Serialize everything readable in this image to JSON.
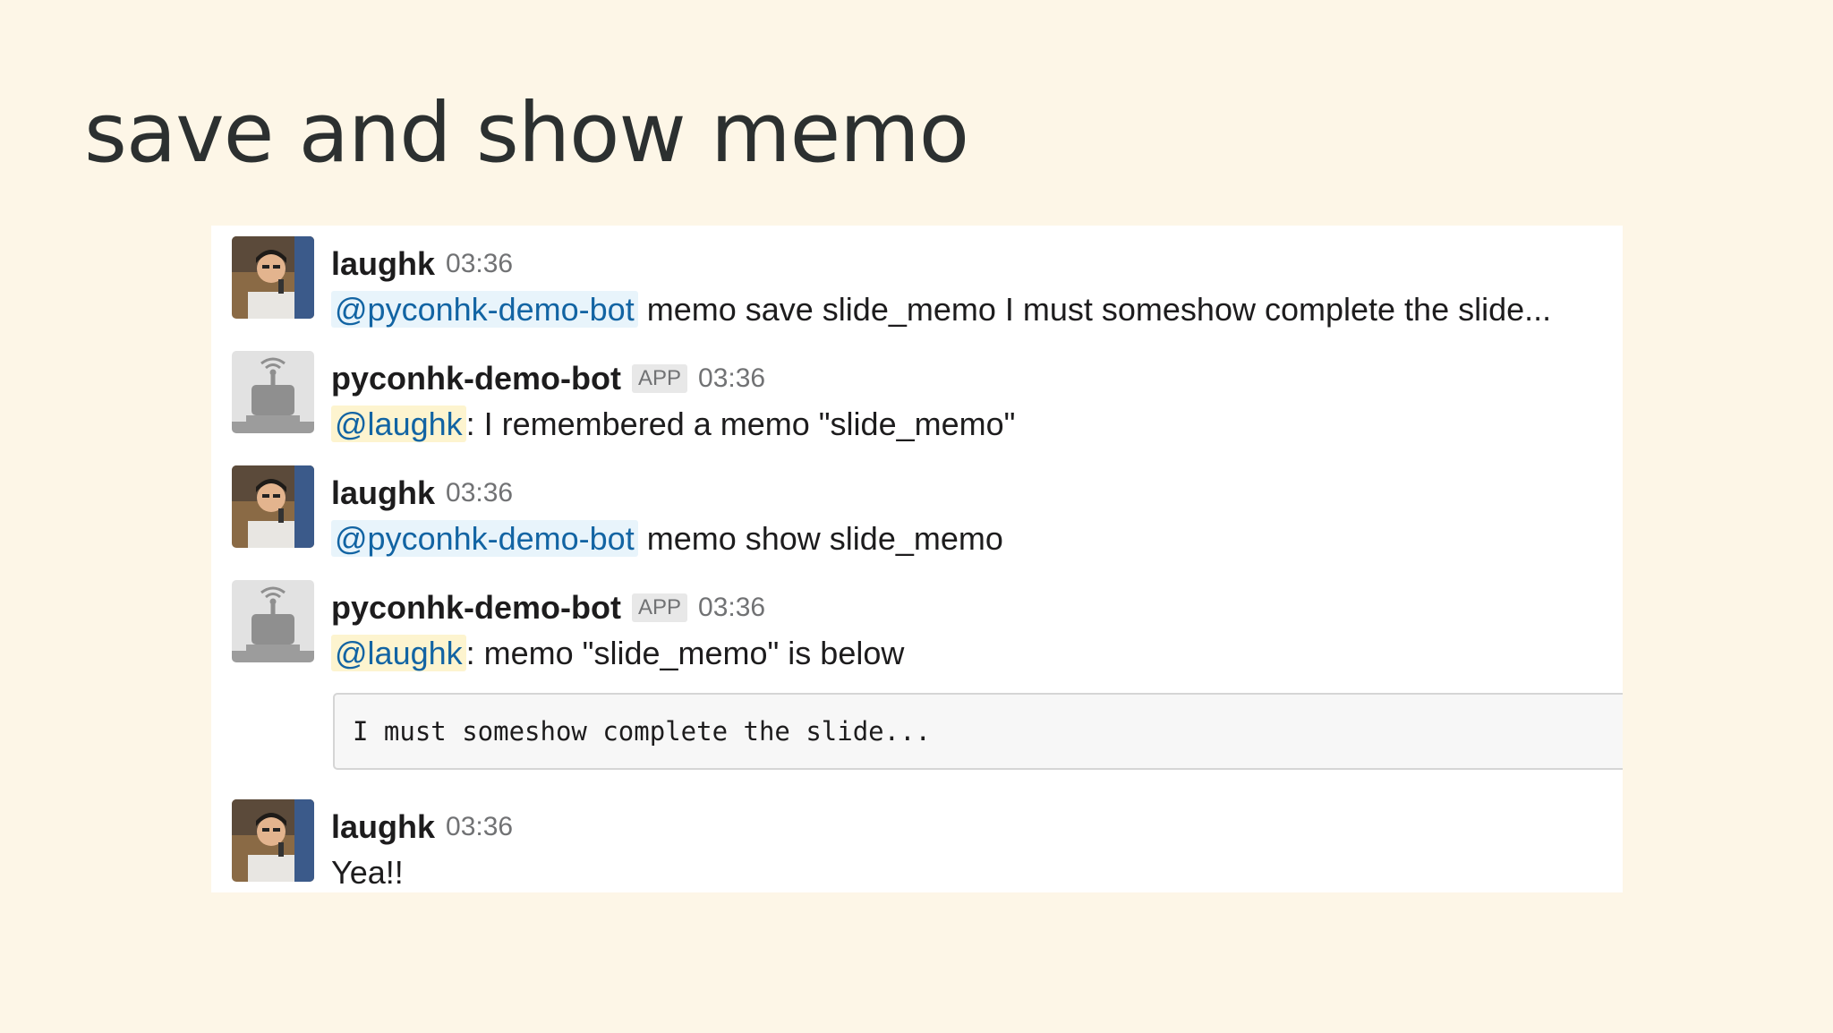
{
  "slide": {
    "title": "save and show memo"
  },
  "messages": [
    {
      "author": "laughk",
      "time": "03:36",
      "mention": "@pyconhk-demo-bot",
      "text": "memo save slide_memo I must someshow complete the slide..."
    },
    {
      "author": "pyconhk-demo-bot",
      "badge": "APP",
      "time": "03:36",
      "mention": "@laughk",
      "text": ": I remembered a memo \"slide_memo\""
    },
    {
      "author": "laughk",
      "time": "03:36",
      "mention": "@pyconhk-demo-bot",
      "text": "memo show slide_memo"
    },
    {
      "author": "pyconhk-demo-bot",
      "badge": "APP",
      "time": "03:36",
      "mention": "@laughk",
      "text": ": memo \"slide_memo\" is below",
      "code": "I must someshow complete the slide..."
    },
    {
      "author": "laughk",
      "time": "03:36",
      "text": "Yea!!"
    }
  ],
  "icons": {
    "user_avatar": "user-photo-avatar",
    "bot_avatar": "bot-default-avatar"
  }
}
